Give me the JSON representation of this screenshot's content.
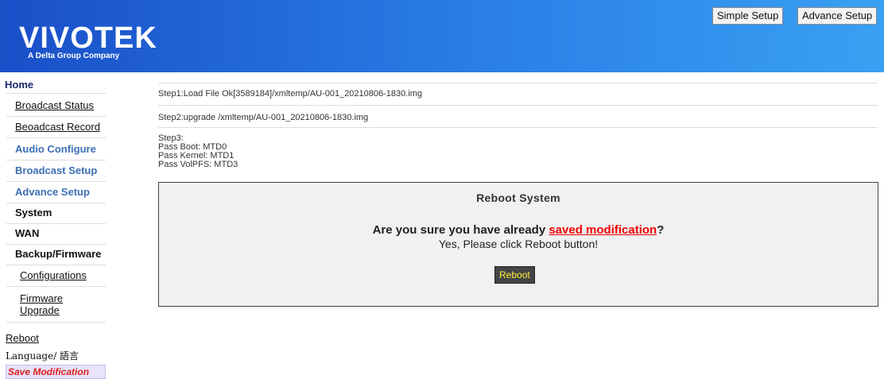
{
  "header": {
    "logo": "VIVOTEK",
    "tagline": "A Delta Group Company",
    "simple_setup": "Simple Setup",
    "advance_setup": "Advance Setup"
  },
  "sidebar": {
    "home": "Home",
    "broadcast_status": "Broadcast Status",
    "broadcast_record": "Beoadcast Record",
    "audio_configure": "Audio Configure",
    "broadcast_setup": "Broadcast Setup",
    "advance_setup": "Advance Setup",
    "system": "System",
    "wan": "WAN",
    "backup_firmware": "Backup/Firmware",
    "configurations": "Configurations",
    "firmware_line1": "Firmware",
    "firmware_line2": "Upgrade",
    "reboot": "Reboot",
    "language": "Language/ 語言",
    "save_modification": "Save Modification"
  },
  "steps": {
    "step1": "Step1:Load File Ok[3589184]/xmltemp/AU-001_20210806-1830.img",
    "step2": "Step2:upgrade /xmltemp/AU-001_20210806-1830.img",
    "step3_title": "Step3:",
    "step3_boot": "Pass Boot: MTD0",
    "step3_kernel": "Pass Kernel: MTD1",
    "step3_volpfs": "Pass VolPFS: MTD3"
  },
  "reboot_box": {
    "title": "Reboot System",
    "question_prefix": "Are you sure you have already ",
    "question_link": "saved modification",
    "question_suffix": "?",
    "yes_text": "Yes, Please click Reboot button!",
    "button": "Reboot"
  }
}
